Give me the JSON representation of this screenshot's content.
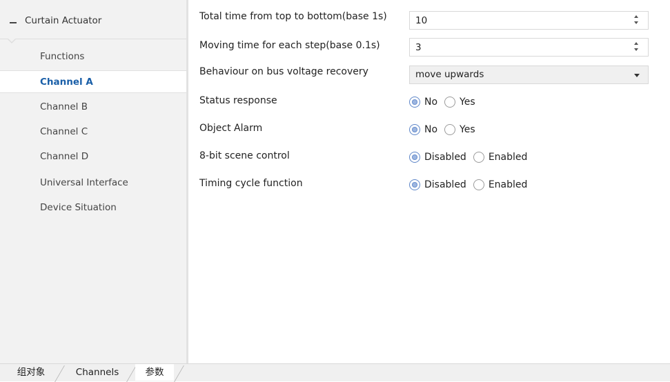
{
  "sidebar": {
    "root_label": "Curtain Actuator",
    "items": [
      {
        "label": "Functions",
        "active": false
      },
      {
        "label": "Channel A",
        "active": true
      },
      {
        "label": "Channel B",
        "active": false
      },
      {
        "label": "Channel C",
        "active": false
      },
      {
        "label": "Channel D",
        "active": false
      },
      {
        "label": "Universal Interface",
        "active": false
      },
      {
        "label": "Device Situation",
        "active": false
      }
    ]
  },
  "params": {
    "total_time": {
      "label": "Total time from top to bottom(base 1s)",
      "value": "10"
    },
    "step_time": {
      "label": "Moving time for each step(base 0.1s)",
      "value": "3"
    },
    "bus_recovery": {
      "label": "Behaviour on bus voltage recovery",
      "value": "move upwards"
    },
    "status_response": {
      "label": "Status response",
      "options": [
        "No",
        "Yes"
      ],
      "selected": "No"
    },
    "object_alarm": {
      "label": "Object Alarm",
      "options": [
        "No",
        "Yes"
      ],
      "selected": "No"
    },
    "scene_control": {
      "label": "8-bit scene control",
      "options": [
        "Disabled",
        "Enabled"
      ],
      "selected": "Disabled"
    },
    "timing_cycle": {
      "label": "Timing cycle function",
      "options": [
        "Disabled",
        "Enabled"
      ],
      "selected": "Disabled"
    }
  },
  "tabs": [
    {
      "label": "组对象",
      "active": false
    },
    {
      "label": "Channels",
      "active": false
    },
    {
      "label": "参数",
      "active": true
    }
  ],
  "colors": {
    "accent_text": "#1a5fa8",
    "radio_checked": "#9db6e0",
    "sidebar_bg": "#f2f2f2"
  }
}
